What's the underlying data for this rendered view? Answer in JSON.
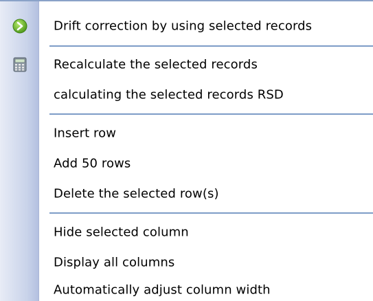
{
  "menu": {
    "items": [
      {
        "label": "Drift correction by using selected records",
        "icon": "green-arrow-icon"
      },
      {
        "label": "Recalculate the selected records",
        "icon": "calculator-icon"
      },
      {
        "label": "calculating the selected records RSD"
      },
      {
        "label": "Insert row"
      },
      {
        "label": "Add 50 rows"
      },
      {
        "label": "Delete the selected row(s)"
      },
      {
        "label": "Hide selected column"
      },
      {
        "label": "Display all columns"
      },
      {
        "label": "Automatically adjust column width"
      }
    ]
  },
  "colors": {
    "separator": "#7d9cc7",
    "icon_strip": "#c9d3ea",
    "arrow_green": "#6ab42a"
  }
}
